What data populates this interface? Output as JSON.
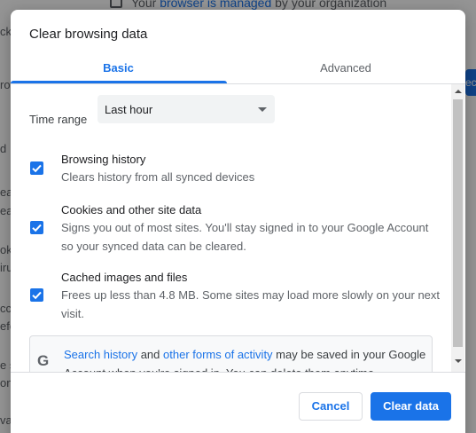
{
  "background": {
    "managed_text": "Your browser is managed by your organization",
    "managed_link": "browser is managed",
    "snippets": [
      "ck",
      "ro",
      "d",
      "ear",
      "ear",
      "ok",
      "iru",
      "ccu",
      "efe",
      "e s",
      "ont",
      "va"
    ],
    "side_button_label": "ec"
  },
  "dialog": {
    "title": "Clear browsing data",
    "tabs": [
      {
        "label": "Basic",
        "selected": true
      },
      {
        "label": "Advanced",
        "selected": false
      }
    ],
    "time_range": {
      "label": "Time range",
      "value": "Last hour"
    },
    "options": [
      {
        "title": "Browsing history",
        "description": "Clears history from all synced devices",
        "checked": true
      },
      {
        "title": "Cookies and other site data",
        "description": "Signs you out of most sites. You'll stay signed in to your Google Account so your synced data can be cleared.",
        "checked": true
      },
      {
        "title": "Cached images and files",
        "description": "Frees up less than 4.8 MB. Some sites may load more slowly on your next visit.",
        "checked": true
      }
    ],
    "info": {
      "link1": "Search history",
      "text1": " and ",
      "link2": "other forms of activity",
      "text2": " may be saved in your Google Account when you're signed in. You can delete them anytime.",
      "icon_letter": "G"
    },
    "buttons": {
      "cancel": "Cancel",
      "clear": "Clear data"
    }
  },
  "colors": {
    "accent": "#1a73e8",
    "text": "#202124",
    "secondary_text": "#5f6368"
  }
}
